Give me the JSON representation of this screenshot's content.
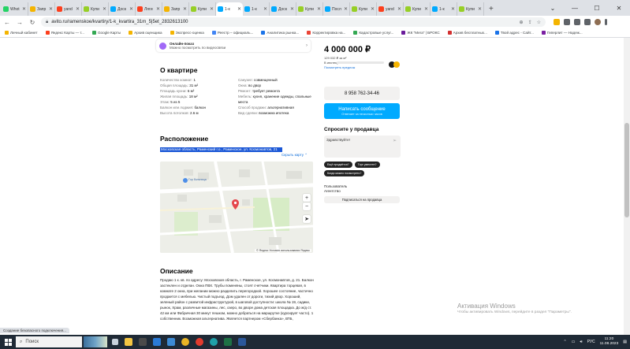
{
  "browser": {
    "tabs": [
      {
        "label": "Whot",
        "color": "#25d366"
      },
      {
        "label": "Запр",
        "color": "#f4b400"
      },
      {
        "label": "yand",
        "color": "#fc3f1d"
      },
      {
        "label": "Купи",
        "color": "#97cf26"
      },
      {
        "label": "Доск",
        "color": "#00aaff"
      },
      {
        "label": "Ляги",
        "color": "#fc3f1d"
      },
      {
        "label": "Запр",
        "color": "#f4b400"
      },
      {
        "label": "Купи",
        "color": "#97cf26"
      },
      {
        "label": "1-к",
        "color": "#00aaff",
        "active": true
      },
      {
        "label": "1-к",
        "color": "#00aaff"
      },
      {
        "label": "Доск",
        "color": "#00aaff"
      },
      {
        "label": "Купи",
        "color": "#97cf26"
      },
      {
        "label": "Посл",
        "color": "#00aaff"
      },
      {
        "label": "Купи",
        "color": "#97cf26"
      },
      {
        "label": "yand",
        "color": "#fc3f1d"
      },
      {
        "label": "Купи",
        "color": "#97cf26"
      },
      {
        "label": "1-к",
        "color": "#00aaff"
      },
      {
        "label": "Купи",
        "color": "#97cf26"
      }
    ],
    "new_tab": "+",
    "url": "avito.ru/ramenskoe/kvartiry/1-k_kvartira_31m_5|5et_2832613100",
    "bookmarks": [
      {
        "label": "Личный кабинет",
        "color": "#f4b400"
      },
      {
        "label": "Яндекс Карты — т...",
        "color": "#fc3f1d"
      },
      {
        "label": "Google Карты",
        "color": "#34a853"
      },
      {
        "label": "Архив оценщика",
        "color": "#f4b400"
      },
      {
        "label": "Экспресс-оценка",
        "color": "#f4b400"
      },
      {
        "label": "Реестр – официаль...",
        "color": "#4285f4"
      },
      {
        "label": "Аналитика рынка...",
        "color": "#1a73e8"
      },
      {
        "label": "Корректировка на...",
        "color": "#ea4335"
      },
      {
        "label": "Кадастровые услуг...",
        "color": "#34a853"
      },
      {
        "label": "ЖК \"Мега\" | БРОКС",
        "color": "#6a1b9a"
      },
      {
        "label": "Архив бесплатных...",
        "color": "#d32f2f"
      },
      {
        "label": "Твой адрес - Сайт...",
        "color": "#1a73e8"
      },
      {
        "label": "Гиперлит — Надеж...",
        "color": "#7b1fa2"
      }
    ]
  },
  "video_card": {
    "title": "Онлайн-показ",
    "subtitle": "Можно посмотреть по видеосвязи"
  },
  "about": {
    "title": "О квартире",
    "left": [
      {
        "k": "Количество комнат:",
        "v": "1"
      },
      {
        "k": "Общая площадь:",
        "v": "31 м²"
      },
      {
        "k": "Площадь кухни:",
        "v": "6 м²"
      },
      {
        "k": "Жилая площадь:",
        "v": "18 м²"
      },
      {
        "k": "Этаж:",
        "v": "5 из 5"
      },
      {
        "k": "Балкон или лоджия:",
        "v": "балкон"
      },
      {
        "k": "Высота потолков:",
        "v": "2.6 м"
      }
    ],
    "right": [
      {
        "k": "Санузел:",
        "v": "совмещенный"
      },
      {
        "k": "Окна:",
        "v": "во двор"
      },
      {
        "k": "Ремонт:",
        "v": "требует ремонта"
      },
      {
        "k": "Мебель:",
        "v": "кухня, хранение одежды, спальные места"
      },
      {
        "k": "Способ продажи:",
        "v": "альтернативная"
      },
      {
        "k": "Вид сделки:",
        "v": "возможна ипотека"
      }
    ]
  },
  "location": {
    "title": "Расположение",
    "address": "Московская область, Раменский г.о., Раменское, ул. Космонавтов, 21",
    "hide_map": "Скрыть карту",
    "map_label": "Гор больница",
    "map_attr": "© Яндекс  Условия использования  Яндекс"
  },
  "description": {
    "title": "Описание",
    "text": "Продаю 1 к. кв. по адресу: Московская область, г. Раменское, ул. Космонавтов, д. 21. Балкон застеклен и отделан. Окна ПВХ. Трубы поменяны, стоят счетчики. Квартира торцевая, в комнате 2 окна, при желании можно разделить перегородкой. Хорошее состояние, частично продается с мебелью. Чистый подъезд. Дом удален от дороги, тихий двор. Хороший, зеленый район с развитой инфраструктурой, в шаговой доступности: школа № 19, садики, рынок, Храм, различные магазины, лес, озеро, во дворе дома детская площадка. До ж/д ст. 42 км или Фабричная 30 минут пешком, можно добраться на маршрутке (курсирует часто). 1 собственник. Возможная альтернатива. Является партнером «Сбербанка», ВТБ,"
  },
  "sidebar": {
    "price": "4 000 000 ₽",
    "price_per_m": "129 032 ₽ за м²",
    "mortgage": "В ипотеку",
    "mortgage_link": "Посмотреть предлож",
    "phone": "8 958 762-34-46",
    "message_btn": "Написать сообщение",
    "message_sub": "Отвечает за несколько часов",
    "ask_title": "Спросите у продавца",
    "ask_input": "Здравствуйте!",
    "chips": [
      "Ещё продаётся?",
      "Торг уместен?",
      "Когда можно посмотреть?"
    ],
    "seller_name": "Пользователь",
    "seller_type": "Агентство",
    "subscribe": "Подписаться на продавца"
  },
  "system": {
    "activate_title": "Активация Windows",
    "activate_sub": "Чтобы активировать Windows, перейдите в раздел \"Параметры\".",
    "status": "Создание безопасного подключения...",
    "search": "Поиск",
    "lang": "РУС",
    "time": "11:20",
    "date": "11.08.2023"
  },
  "colors": {
    "avito_blue": "#00aaff",
    "selection": "#1a57d6",
    "pin": "#e5484d"
  }
}
